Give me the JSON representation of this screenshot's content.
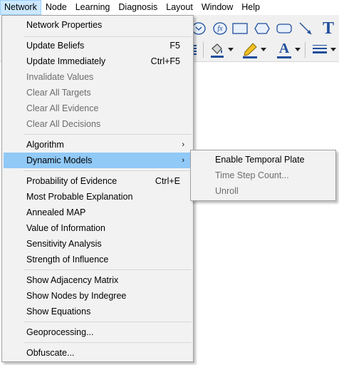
{
  "menubar": {
    "items": [
      "Network",
      "Node",
      "Learning",
      "Diagnosis",
      "Layout",
      "Window",
      "Help"
    ]
  },
  "toolbar": {
    "text_tool_glyph": "T",
    "font_color_glyph": "A",
    "function_node_glyph": "fx",
    "accent": "#1f4e9c",
    "pencil_color": "#f0c020"
  },
  "menu": {
    "network_properties": "Network Properties",
    "update_beliefs": "Update Beliefs",
    "update_beliefs_shortcut": "F5",
    "update_immediately": "Update Immediately",
    "update_immediately_shortcut": "Ctrl+F5",
    "invalidate_values": "Invalidate Values",
    "clear_all_targets": "Clear All Targets",
    "clear_all_evidence": "Clear All Evidence",
    "clear_all_decisions": "Clear All Decisions",
    "algorithm": "Algorithm",
    "dynamic_models": "Dynamic Models",
    "probability_of_evidence": "Probability of Evidence",
    "probability_of_evidence_shortcut": "Ctrl+E",
    "most_probable_explanation": "Most Probable Explanation",
    "annealed_map": "Annealed MAP",
    "value_of_information": "Value of Information",
    "sensitivity_analysis": "Sensitivity Analysis",
    "strength_of_influence": "Strength of Influence",
    "show_adjacency_matrix": "Show Adjacency Matrix",
    "show_nodes_by_indegree": "Show Nodes by Indegree",
    "show_equations": "Show Equations",
    "geoprocessing": "Geoprocessing...",
    "obfuscate": "Obfuscate...",
    "submenu_arrow": "›"
  },
  "submenu": {
    "enable_temporal_plate": "Enable Temporal Plate",
    "time_step_count": "Time Step Count...",
    "unroll": "Unroll"
  },
  "colors": {
    "highlight": "#91c9f7",
    "menubar_active": "#cce8ff",
    "disabled_text": "#6d6d6d"
  }
}
